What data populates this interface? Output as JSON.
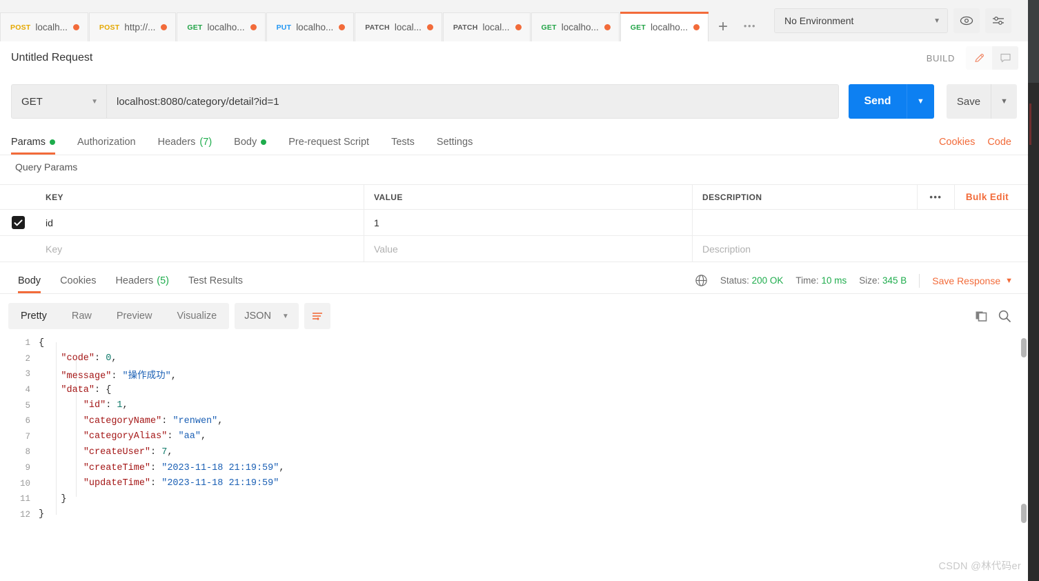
{
  "colors": {
    "accent_orange": "#f26b3a",
    "send_blue": "#0d80f2",
    "success_green": "#1eac4c",
    "method_post": "#e5a800",
    "method_get": "#22a447",
    "method_put": "#2196f3",
    "method_patch": "#5a5a5a"
  },
  "tabbar": {
    "tabs": [
      {
        "method": "POST",
        "label": "localh...",
        "unsaved": true,
        "active": false
      },
      {
        "method": "POST",
        "label": "http://...",
        "unsaved": true,
        "active": false
      },
      {
        "method": "GET",
        "label": "localho...",
        "unsaved": true,
        "active": false
      },
      {
        "method": "PUT",
        "label": "localho...",
        "unsaved": true,
        "active": false
      },
      {
        "method": "PATCH",
        "label": "local...",
        "unsaved": true,
        "active": false
      },
      {
        "method": "PATCH",
        "label": "local...",
        "unsaved": true,
        "active": false
      },
      {
        "method": "GET",
        "label": "localho...",
        "unsaved": true,
        "active": false
      },
      {
        "method": "GET",
        "label": "localho...",
        "unsaved": true,
        "active": true
      }
    ],
    "new_tab_label": "+",
    "more_tabs_label": "000",
    "environment": "No Environment",
    "eye_icon": "eye-icon",
    "settings_icon": "sliders-icon"
  },
  "request": {
    "title": "Untitled Request",
    "build_label": "BUILD",
    "edit_icon": "pencil-icon",
    "comment_icon": "comment-icon",
    "method": "GET",
    "url": "localhost:8080/category/detail?id=1",
    "send_label": "Send",
    "save_label": "Save",
    "tabs": [
      {
        "label": "Params",
        "dot": true,
        "count": "",
        "active": true
      },
      {
        "label": "Authorization",
        "dot": false,
        "count": "",
        "active": false
      },
      {
        "label": "Headers",
        "dot": false,
        "count": "(7)",
        "active": false
      },
      {
        "label": "Body",
        "dot": true,
        "count": "",
        "active": false
      },
      {
        "label": "Pre-request Script",
        "dot": false,
        "count": "",
        "active": false
      },
      {
        "label": "Tests",
        "dot": false,
        "count": "",
        "active": false
      },
      {
        "label": "Settings",
        "dot": false,
        "count": "",
        "active": false
      }
    ],
    "cookies_link": "Cookies",
    "code_link": "Code"
  },
  "query_params": {
    "section_title": "Query Params",
    "columns": [
      "KEY",
      "VALUE",
      "DESCRIPTION"
    ],
    "more_label": "•••",
    "bulk_edit_label": "Bulk Edit",
    "rows": [
      {
        "checked": true,
        "key": "id",
        "value": "1",
        "description": ""
      }
    ],
    "placeholder_row": {
      "key": "Key",
      "value": "Value",
      "description": "Description"
    }
  },
  "response": {
    "tabs": [
      {
        "label": "Body",
        "count": "",
        "active": true
      },
      {
        "label": "Cookies",
        "count": "",
        "active": false
      },
      {
        "label": "Headers",
        "count": "(5)",
        "active": false
      },
      {
        "label": "Test Results",
        "count": "",
        "active": false
      }
    ],
    "globe_icon": "globe-icon",
    "status_label": "Status:",
    "status_value": "200 OK",
    "time_label": "Time:",
    "time_value": "10 ms",
    "size_label": "Size:",
    "size_value": "345 B",
    "save_response_label": "Save Response",
    "format_tabs": [
      {
        "label": "Pretty",
        "active": true
      },
      {
        "label": "Raw",
        "active": false
      },
      {
        "label": "Preview",
        "active": false
      },
      {
        "label": "Visualize",
        "active": false
      }
    ],
    "language": "JSON",
    "wrap_icon": "word-wrap-icon",
    "copy_icon": "copy-icon",
    "search_icon": "search-icon",
    "body_lines": [
      {
        "n": "1",
        "tokens": [
          {
            "t": "p",
            "v": "{"
          }
        ]
      },
      {
        "n": "2",
        "tokens": [
          {
            "t": "p",
            "v": "    "
          },
          {
            "t": "k",
            "v": "\"code\""
          },
          {
            "t": "p",
            "v": ": "
          },
          {
            "t": "n",
            "v": "0"
          },
          {
            "t": "p",
            "v": ","
          }
        ]
      },
      {
        "n": "3",
        "tokens": [
          {
            "t": "p",
            "v": "    "
          },
          {
            "t": "k",
            "v": "\"message\""
          },
          {
            "t": "p",
            "v": ": "
          },
          {
            "t": "s",
            "v": "\"操作成功\""
          },
          {
            "t": "p",
            "v": ","
          }
        ]
      },
      {
        "n": "4",
        "tokens": [
          {
            "t": "p",
            "v": "    "
          },
          {
            "t": "k",
            "v": "\"data\""
          },
          {
            "t": "p",
            "v": ": {"
          }
        ]
      },
      {
        "n": "5",
        "tokens": [
          {
            "t": "p",
            "v": "        "
          },
          {
            "t": "k",
            "v": "\"id\""
          },
          {
            "t": "p",
            "v": ": "
          },
          {
            "t": "n",
            "v": "1"
          },
          {
            "t": "p",
            "v": ","
          }
        ]
      },
      {
        "n": "6",
        "tokens": [
          {
            "t": "p",
            "v": "        "
          },
          {
            "t": "k",
            "v": "\"categoryName\""
          },
          {
            "t": "p",
            "v": ": "
          },
          {
            "t": "s",
            "v": "\"renwen\""
          },
          {
            "t": "p",
            "v": ","
          }
        ]
      },
      {
        "n": "7",
        "tokens": [
          {
            "t": "p",
            "v": "        "
          },
          {
            "t": "k",
            "v": "\"categoryAlias\""
          },
          {
            "t": "p",
            "v": ": "
          },
          {
            "t": "s",
            "v": "\"aa\""
          },
          {
            "t": "p",
            "v": ","
          }
        ]
      },
      {
        "n": "8",
        "tokens": [
          {
            "t": "p",
            "v": "        "
          },
          {
            "t": "k",
            "v": "\"createUser\""
          },
          {
            "t": "p",
            "v": ": "
          },
          {
            "t": "n",
            "v": "7"
          },
          {
            "t": "p",
            "v": ","
          }
        ]
      },
      {
        "n": "9",
        "tokens": [
          {
            "t": "p",
            "v": "        "
          },
          {
            "t": "k",
            "v": "\"createTime\""
          },
          {
            "t": "p",
            "v": ": "
          },
          {
            "t": "s",
            "v": "\"2023-11-18 21:19:59\""
          },
          {
            "t": "p",
            "v": ","
          }
        ]
      },
      {
        "n": "10",
        "tokens": [
          {
            "t": "p",
            "v": "        "
          },
          {
            "t": "k",
            "v": "\"updateTime\""
          },
          {
            "t": "p",
            "v": ": "
          },
          {
            "t": "s",
            "v": "\"2023-11-18 21:19:59\""
          }
        ]
      },
      {
        "n": "11",
        "tokens": [
          {
            "t": "p",
            "v": "    }"
          }
        ]
      },
      {
        "n": "12",
        "tokens": [
          {
            "t": "p",
            "v": "}"
          }
        ]
      }
    ]
  },
  "watermark": "CSDN @林代码er"
}
